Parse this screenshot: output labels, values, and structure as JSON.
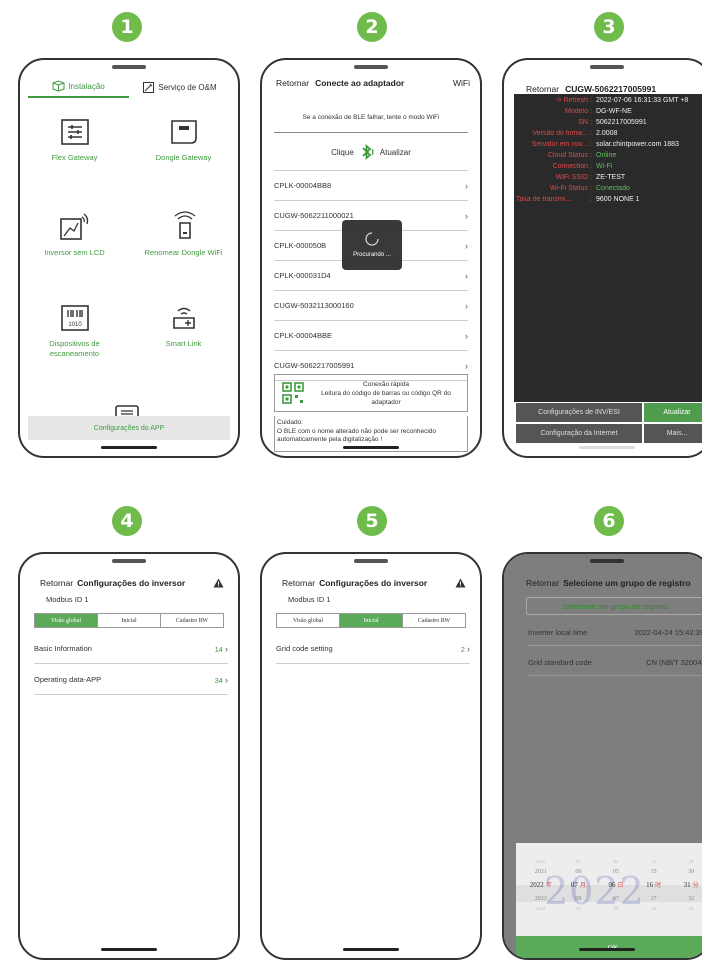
{
  "steps": [
    "1",
    "2",
    "3",
    "4",
    "5",
    "6"
  ],
  "colors": {
    "accent": "#3f9a3f",
    "step_badge": "#6fbb4b",
    "dark_bg": "#2a2a2a",
    "label_red": "#d94a4a"
  },
  "phone1": {
    "tabs": [
      {
        "label": "Instalação",
        "icon": "box-icon",
        "active": true
      },
      {
        "label": "Serviço de O&M",
        "icon": "wrench-doc-icon",
        "active": false
      }
    ],
    "items": [
      {
        "label": "Flex Gateway",
        "icon": "sliders-icon"
      },
      {
        "label": "Dongle Gateway",
        "icon": "dongle-icon"
      },
      {
        "label": "Inversor sem LCD",
        "icon": "inverter-wifi-icon"
      },
      {
        "label": "Renomear Dongle WiFi",
        "icon": "dongle-wifi-icon"
      },
      {
        "label": "Dispositivos de escaneamento",
        "icon": "barcode-icon",
        "code": "1010"
      },
      {
        "label": "Smart Link",
        "icon": "smart-link-icon"
      }
    ],
    "extra_icon": "monitor-list-icon",
    "config_label": "Configurações do APP"
  },
  "phone2": {
    "back": "Retornar",
    "title": "Conecte ao adaptador",
    "wifi": "WiFi",
    "hint": "Se a conexão de BLE falhar, tente o modo WiFi",
    "click_label": "Clique",
    "refresh_label": "Atualizar",
    "devices": [
      "CPLK-00004BB8",
      "CUGW-5062211000021",
      "CPLK-000050B",
      "CPLK-000031D4",
      "CUGW-5032113000160",
      "CPLK-00004BBE",
      "CUGW-5062217005991"
    ],
    "loading": "Procurando ...",
    "quick_title": "Conexão rápida",
    "quick_desc": "Leitura do código de barras ou código QR do adaptador",
    "caution_title": "Cuidado:",
    "caution_text": "O BLE com o nome alterado não pode ser reconhecido automaticamente pela digitalização !"
  },
  "phone3": {
    "back": "Retornar",
    "title": "CUGW-5062217005991",
    "fields": [
      {
        "key": "-> Refresh",
        "value": "2022-07-06 16:31:33 GMT +8",
        "color": "#d94a4a"
      },
      {
        "key": "Modelo",
        "value": "DG-WF-NE",
        "color": "#d94a4a"
      },
      {
        "key": "SN",
        "value": "5062217005991",
        "color": "#d94a4a"
      },
      {
        "key": "Versão do firmw...",
        "value": "2.0008",
        "color": "#d94a4a"
      },
      {
        "key": "Servidor em nuv...",
        "value": "solar.chintpower.com 1883",
        "color": "#d94a4a"
      },
      {
        "key": "Cloud Status",
        "value": "Online",
        "color": "#d94a4a",
        "value_color": "#5fbf5f"
      },
      {
        "key": "Connection",
        "value": "Wi-Fi",
        "color": "#d94a4a",
        "value_color": "#5fbf5f"
      },
      {
        "key": "WiFi SSID",
        "value": "ZE-TEST",
        "color": "#d94a4a"
      },
      {
        "key": "Wi-Fi Status",
        "value": "Conectado",
        "color": "#d94a4a",
        "value_color": "#5fbf5f"
      },
      {
        "key": "Taxa de transmi...",
        "value": "9600 NONE 1",
        "color": "#d94a4a"
      }
    ],
    "btn_inv": "Configurações de INV/ESI",
    "btn_refresh": "Atualizar",
    "btn_net": "Configuração da Internet",
    "btn_more": "Mais..."
  },
  "phone4": {
    "back": "Retornar",
    "title": "Configurações do inversor",
    "modbus": "Modbus ID 1",
    "segments": [
      "Visão global",
      "Inicial",
      "Cadastro RW"
    ],
    "active_segment": 0,
    "rows": [
      {
        "label": "Basic Information",
        "count": "14"
      },
      {
        "label": "Operating data-APP",
        "count": "34"
      }
    ]
  },
  "phone5": {
    "back": "Retornar",
    "title": "Configurações do inversor",
    "modbus": "Modbus ID 1",
    "segments": [
      "Visão global",
      "Inicial",
      "Cadastro RW"
    ],
    "active_segment": 1,
    "rows": [
      {
        "label": "Grid code setting",
        "count": "2"
      }
    ]
  },
  "phone6": {
    "back": "Retornar",
    "title": "Selecione um grupo de registro",
    "select_btn": "Selecione um grupo de registro",
    "rows": [
      {
        "label": "Inverter local time",
        "value": "2022-04-24  15:42:39"
      },
      {
        "label": "Grid standard code",
        "value": "CN (NB/T 32004)"
      }
    ],
    "picker_cols": [
      {
        "values": [
          "2020",
          "2021",
          "2022",
          "2023",
          "2024"
        ],
        "unit": "年"
      },
      {
        "values": [
          "05",
          "06",
          "07",
          "08",
          "09"
        ],
        "unit": "月"
      },
      {
        "values": [
          "04",
          "05",
          "06",
          "07",
          "08"
        ],
        "unit": "日"
      },
      {
        "values": [
          "14",
          "15",
          "16",
          "17",
          "18"
        ],
        "unit": "时"
      },
      {
        "values": [
          "29",
          "30",
          "31",
          "32",
          "33"
        ],
        "unit": "分"
      }
    ],
    "watermark": "2022",
    "ok": "OK"
  }
}
